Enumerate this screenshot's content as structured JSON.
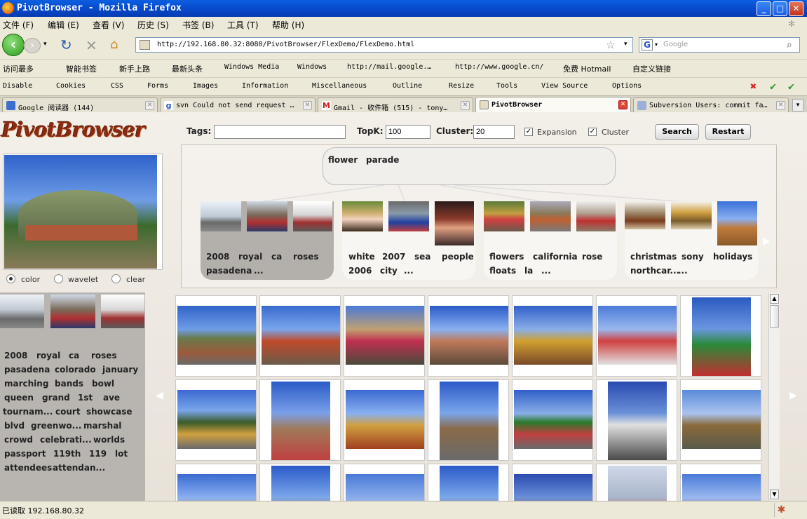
{
  "window": {
    "title": "PivotBrowser - Mozilla Firefox"
  },
  "menu": [
    "文件 (F)",
    "编辑 (E)",
    "查看 (V)",
    "历史 (S)",
    "书签 (B)",
    "工具 (T)",
    "帮助 (H)"
  ],
  "nav": {
    "url": "http://192.168.80.32:8080/PivotBrowser/FlexDemo/FlexDemo.html",
    "search_placeholder": "Google"
  },
  "bookmarks": [
    "访问最多",
    "智能书签",
    "新手上路",
    "最新头条",
    "Windows Media",
    "Windows",
    "http://mail.google.…",
    "http://www.google.cn/",
    "免费 Hotmail",
    "自定义链接"
  ],
  "devbar": [
    "Disable",
    "Cookies",
    "CSS",
    "Forms",
    "Images",
    "Information",
    "Miscellaneous",
    "Outline",
    "Resize",
    "Tools",
    "View Source",
    "Options"
  ],
  "tabs": [
    {
      "label": "Google 阅读器 (144)"
    },
    {
      "label": "svn Could not send request …"
    },
    {
      "label": "Gmail - 收件箱 (515) - tony…"
    },
    {
      "label": "PivotBrowser",
      "active": true
    },
    {
      "label": "Subversion Users: commit fa…"
    }
  ],
  "app": {
    "brand": "PivotBrowser",
    "tags_label": "Tags:",
    "tags_value": "",
    "topk_label": "TopK:",
    "topk_value": "100",
    "cluster_label": "Cluster:",
    "cluster_value": "20",
    "expansion_label": "Expansion",
    "expansion_checked": true,
    "cluster_check_label": "Cluster",
    "cluster_checked": true,
    "search_button": "Search",
    "restart_button": "Restart",
    "radios": [
      {
        "label": "color",
        "selected": true
      },
      {
        "label": "wavelet",
        "selected": false
      },
      {
        "label": "clear",
        "selected": false
      }
    ],
    "root_tags": [
      "flower",
      "parade"
    ],
    "clusters": [
      {
        "lines": [
          [
            "2008",
            "royal",
            "ca",
            "roses"
          ],
          [
            "pasadena",
            "..."
          ]
        ],
        "selected": true
      },
      {
        "lines": [
          [
            "white",
            "2007",
            "sea",
            "people"
          ],
          [
            "2006",
            "city",
            "..."
          ]
        ],
        "selected": false
      },
      {
        "lines": [
          [
            "flowers",
            "california",
            "rose"
          ],
          [
            "floats",
            "la",
            "..."
          ]
        ],
        "selected": false
      },
      {
        "lines": [
          [
            "christmas",
            "sony",
            "holidays"
          ],
          [
            "northcar...",
            "..."
          ]
        ],
        "selected": false
      }
    ],
    "left_tags": [
      [
        "2008",
        "royal",
        "ca",
        "roses"
      ],
      [
        "pasadena",
        "colorado",
        "january"
      ],
      [
        "marching",
        "bands",
        "bowl"
      ],
      [
        "queen",
        "grand",
        "1st",
        "ave"
      ],
      [
        "tournam...",
        "court",
        "showcase"
      ],
      [
        "blvd",
        "greenwo...",
        "marshal"
      ],
      [
        "crowd",
        "celebrati...",
        "worlds"
      ],
      [
        "passport",
        "119th",
        "119",
        "lot"
      ],
      [
        "attendees",
        "attendan..."
      ]
    ]
  },
  "status": {
    "text": "已读取 192.168.80.32"
  }
}
